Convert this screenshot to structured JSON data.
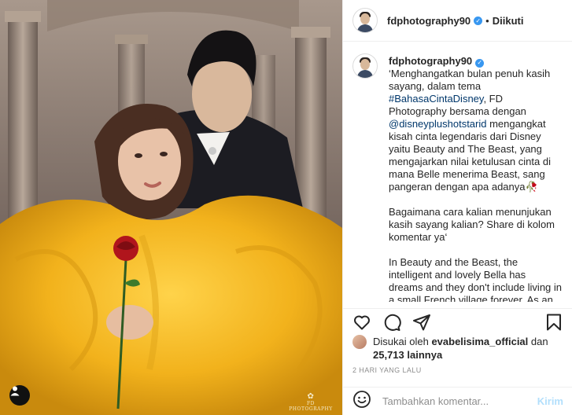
{
  "header": {
    "username": "fdphotography90",
    "separator": "•",
    "follow_label": "Diikuti"
  },
  "caption": {
    "username": "fdphotography90",
    "paragraphs": [
      {
        "pre": "‘Menghangatkan bulan penuh kasih sayang, dalam tema ",
        "hashtag": "#BahasaCintaDisney",
        "mid": ", FD Photography bersama dengan ",
        "mention": "@disneyplushotstarid",
        "post": " mengangkat kisah cinta legendaris dari Disney yaitu Beauty and The Beast, yang mengajarkan nilai ketulusan cinta di mana Belle menerima Beast, sang pangeran dengan apa adanya🥀"
      },
      {
        "text": "Bagaimana cara kalian menunjukan kasih sayang kalian? Share di kolom komentar ya‘"
      },
      {
        "text": "In Beauty and the Beast, the intelligent and lovely Bella has dreams and they don't include living in a small French village forever. As an"
      }
    ]
  },
  "actions": {
    "like_icon": "heart-icon",
    "comment_icon": "comment-icon",
    "share_icon": "share-icon",
    "save_icon": "bookmark-icon"
  },
  "likes": {
    "prefix": "Disukai oleh ",
    "liker": "evabelisima_official",
    "connector": " dan",
    "count": "25,713 lainnya"
  },
  "timestamp": "2 HARI YANG LALU",
  "comment": {
    "placeholder": "Tambahkan komentar...",
    "post_label": "Kirim"
  },
  "photo": {
    "watermark": "FD PHOTOGRAPHY",
    "tag_icon": "user-tag-icon"
  },
  "colors": {
    "accent_blue": "#3897f0",
    "link_blue": "#00376b",
    "post_disabled": "#b2dffc",
    "dress_yellow": "#f2b21c"
  }
}
